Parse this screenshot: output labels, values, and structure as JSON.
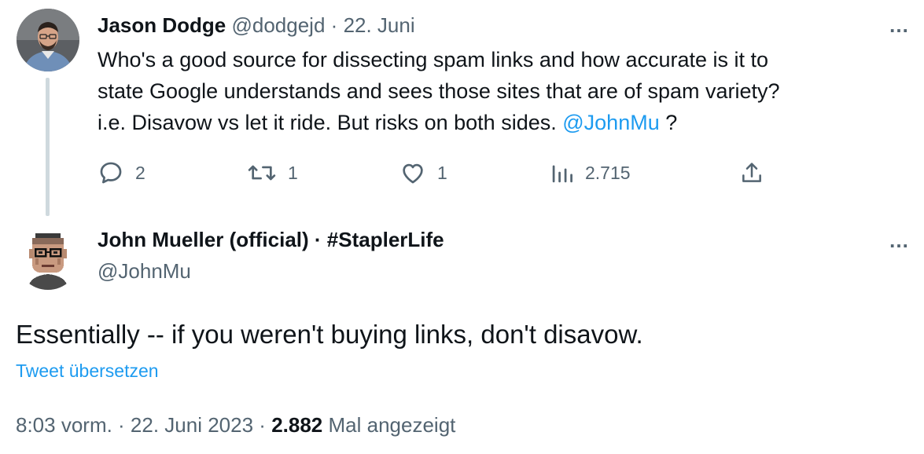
{
  "parent_tweet": {
    "author_name": "Jason Dodge",
    "handle": "@dodgejd",
    "separator": "·",
    "date": "22. Juni",
    "more_icon": "…",
    "text_lines": [
      "Who's a good source for dissecting spam links and how accurate is it to",
      "state Google understands and sees those sites that are of spam variety?"
    ],
    "text_line3_prefix": "i.e. Disavow vs let it ride. But risks on both sides.",
    "mention": "@JohnMu",
    "text_line3_suffix": "?",
    "replies": "2",
    "retweets": "1",
    "likes": "1",
    "views": "2.715"
  },
  "main_tweet": {
    "author_name": "John Mueller (official) · #StaplerLife",
    "handle": "@JohnMu",
    "more_icon": "…",
    "text": "Essentially -- if you weren't buying links, don't disavow.",
    "translate_link": "Tweet übersetzen",
    "timestamp": "8:03 vorm. · 22. Juni 2023 ·",
    "view_count": "2.882",
    "views_label": "Mal angezeigt"
  },
  "colors": {
    "accent": "#1d9bf0",
    "muted": "#536471",
    "text": "#0f1419",
    "thread_line": "#cfd9de"
  }
}
